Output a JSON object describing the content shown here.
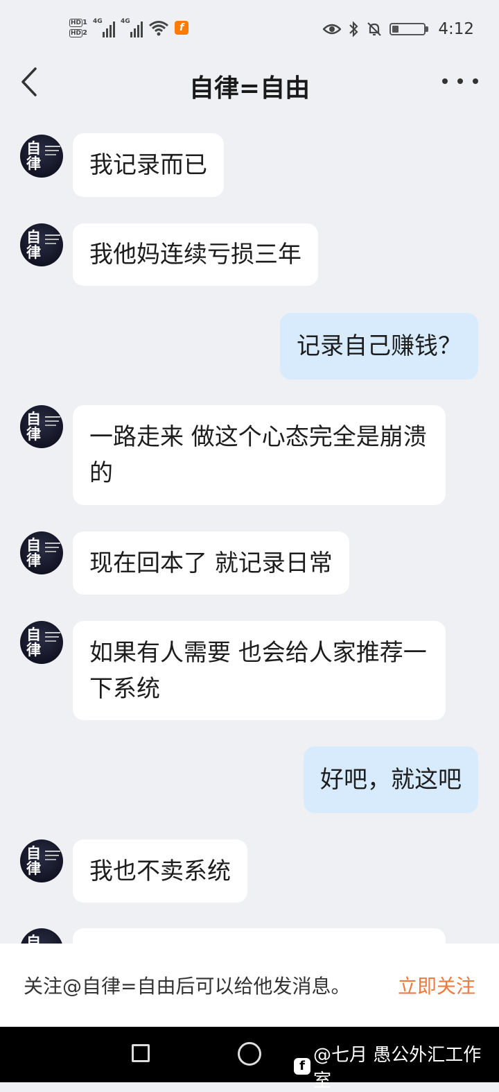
{
  "status_bar": {
    "time": "4:12",
    "hd1": "HD",
    "hd2": "HD",
    "net1": "4G",
    "net2": "4G",
    "icons": [
      "hd-icon",
      "signal-icon",
      "wifi-icon",
      "app-notification-icon",
      "eye-icon",
      "bluetooth-icon",
      "mute-icon",
      "battery-icon"
    ],
    "battery_level": 0.2
  },
  "header": {
    "title": "自律=自由"
  },
  "messages": [
    {
      "side": "in",
      "text": "我记录而已"
    },
    {
      "side": "in",
      "text": "我他妈连续亏损三年"
    },
    {
      "side": "out",
      "text": "记录自己赚钱？"
    },
    {
      "side": "in",
      "text": "一路走来 做这个心态完全是崩溃的"
    },
    {
      "side": "in",
      "text": "现在回本了 就记录日常"
    },
    {
      "side": "in",
      "text": "如果有人需要 也会给人家推荐一下系统"
    },
    {
      "side": "out",
      "text": "好吧，就这吧"
    },
    {
      "side": "in",
      "text": "我也不卖系统"
    }
  ],
  "avatar": {
    "glyph": "自律"
  },
  "follow_bar": {
    "text": "关注@自律=自由后可以给他发消息。",
    "action": "立即关注",
    "action_color": "#f07a3c"
  },
  "watermark": {
    "text": "@七月  愚公外汇工作室"
  }
}
